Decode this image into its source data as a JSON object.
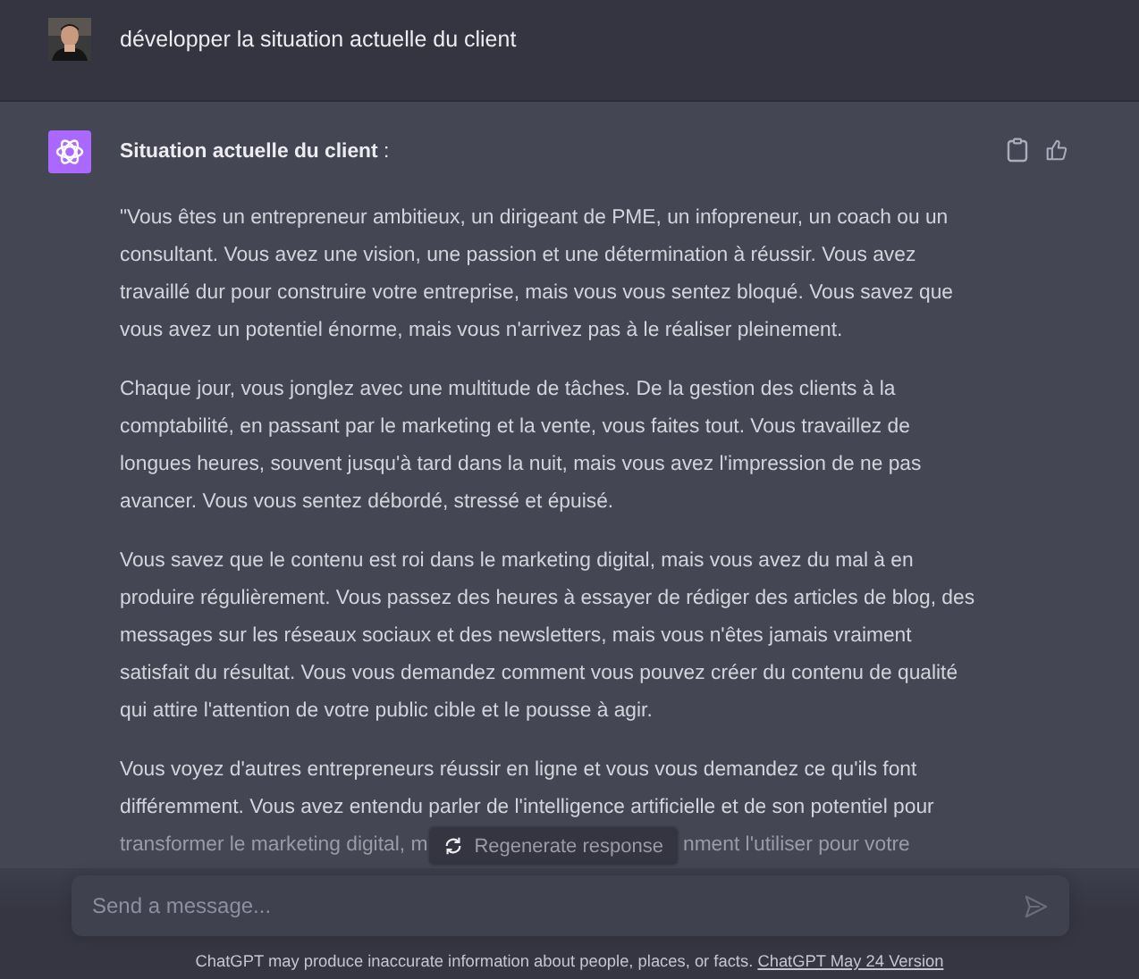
{
  "user_message": {
    "text": "développer la situation actuelle du client"
  },
  "assistant_message": {
    "title": "Situation actuelle du client",
    "title_suffix": " :",
    "paragraphs": [
      "\"Vous êtes un entrepreneur ambitieux, un dirigeant de PME, un infopreneur, un coach ou un consultant. Vous avez une vision, une passion et une détermination à réussir. Vous avez travaillé dur pour construire votre entreprise, mais vous vous sentez bloqué. Vous savez que vous avez un potentiel énorme, mais vous n'arrivez pas à le réaliser pleinement.",
      "Chaque jour, vous jonglez avec une multitude de tâches. De la gestion des clients à la comptabilité, en passant par le marketing et la vente, vous faites tout. Vous travaillez de longues heures, souvent jusqu'à tard dans la nuit, mais vous avez l'impression de ne pas avancer. Vous vous sentez débordé, stressé et épuisé.",
      "Vous savez que le contenu est roi dans le marketing digital, mais vous avez du mal à en produire régulièrement. Vous passez des heures à essayer de rédiger des articles de blog, des messages sur les réseaux sociaux et des newsletters, mais vous n'êtes jamais vraiment satisfait du résultat. Vous vous demandez comment vous pouvez créer du contenu de qualité qui attire l'attention de votre public cible et le pousse à agir.",
      "Vous voyez d'autres entrepreneurs réussir en ligne et vous vous demandez ce qu'ils font différemment. Vous avez entendu parler de l'intelligence artificielle et de son potentiel pour"
    ],
    "last_line_left": "transformer le marketing digital, m",
    "last_line_right": "nment l'utiliser pour votre"
  },
  "regenerate_button": {
    "label": "Regenerate response"
  },
  "composer": {
    "placeholder": "Send a message..."
  },
  "footer": {
    "text": "ChatGPT may produce inaccurate information about people, places, or facts.",
    "link": "ChatGPT May 24 Version"
  }
}
